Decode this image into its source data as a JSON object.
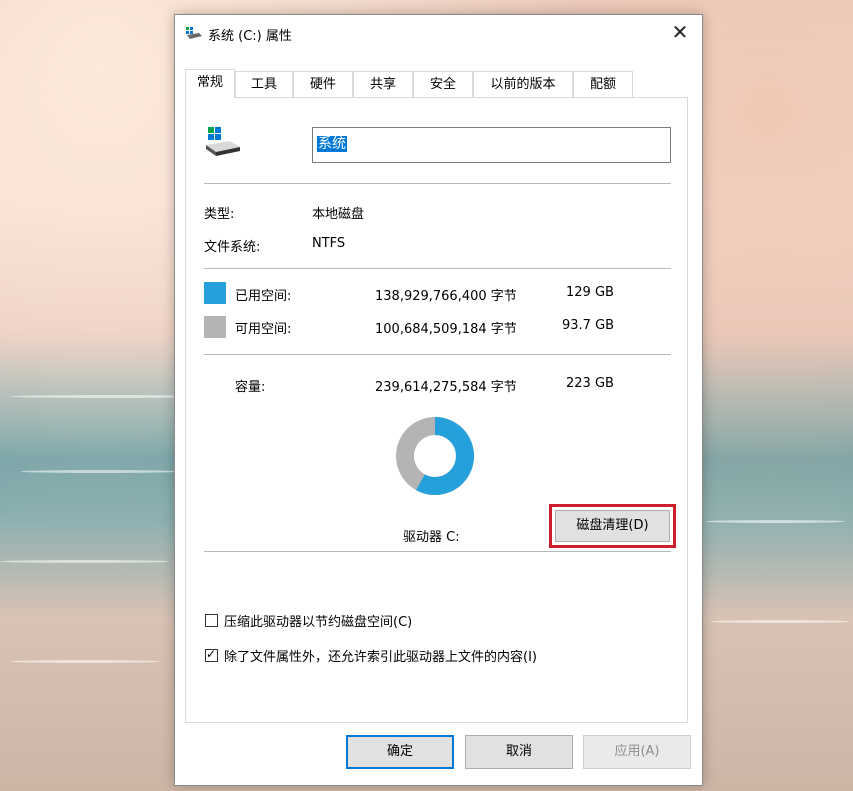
{
  "window": {
    "title": "系统 (C:) 属性",
    "close_glyph": "✕"
  },
  "tabs": [
    "常规",
    "工具",
    "硬件",
    "共享",
    "安全",
    "以前的版本",
    "配额"
  ],
  "active_tab": "常规",
  "drive_name": "系统",
  "info": {
    "type_label": "类型:",
    "type_value": "本地磁盘",
    "fs_label": "文件系统:",
    "fs_value": "NTFS"
  },
  "space": {
    "used": {
      "label": "已用空间:",
      "bytes": "138,929,766,400 字节",
      "size": "129 GB",
      "color": "#26a0da"
    },
    "free": {
      "label": "可用空间:",
      "bytes": "100,684,509,184 字节",
      "size": "93.7 GB",
      "color": "#b4b4b4"
    },
    "capacity": {
      "label": "容量:",
      "bytes": "239,614,275,584 字节",
      "size": "223 GB"
    },
    "used_fraction": 0.58
  },
  "drive_label": "驱动器 C:",
  "cleanup_button": "磁盘清理(D)",
  "options": {
    "compress": {
      "label": "压缩此驱动器以节约磁盘空间(C)",
      "checked": false
    },
    "index": {
      "label": "除了文件属性外，还允许索引此驱动器上文件的内容(I)",
      "checked": true
    }
  },
  "buttons": {
    "ok": "确定",
    "cancel": "取消",
    "apply": "应用(A)"
  },
  "colors": {
    "accent": "#0078d7",
    "highlight_box": "#cc1f2b"
  }
}
